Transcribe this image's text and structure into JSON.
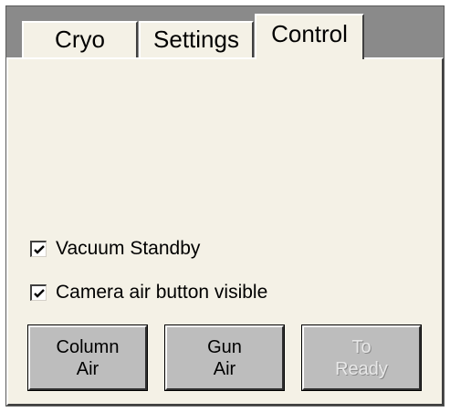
{
  "tabs": [
    {
      "label": "Cryo",
      "active": false
    },
    {
      "label": "Settings",
      "active": false
    },
    {
      "label": "Control",
      "active": true
    }
  ],
  "options": {
    "vacuum_standby": {
      "label": "Vacuum Standby",
      "checked": true
    },
    "camera_air_visible": {
      "label": "Camera air button visible",
      "checked": true
    }
  },
  "buttons": {
    "column_air": {
      "line1": "Column",
      "line2": "Air",
      "enabled": true
    },
    "gun_air": {
      "line1": "Gun",
      "line2": "Air",
      "enabled": true
    },
    "to_ready": {
      "line1": "To",
      "line2": "Ready",
      "enabled": false
    }
  }
}
